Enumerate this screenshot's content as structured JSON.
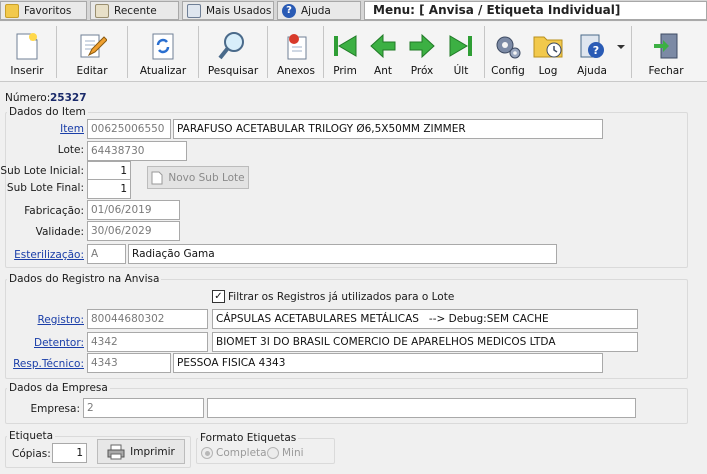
{
  "tabs": {
    "favoritos": "Favoritos",
    "recente": "Recente",
    "mais_usados": "Mais Usados",
    "ajuda": "Ajuda"
  },
  "menu_title": "Menu: [ Anvisa / Etiqueta Individual]",
  "toolbar": {
    "inserir": "Inserir",
    "editar": "Editar",
    "atualizar": "Atualizar",
    "pesquisar": "Pesquisar",
    "anexos": "Anexos",
    "prim": "Prim",
    "ant": "Ant",
    "prox": "Próx",
    "ult": "Últ",
    "config": "Config",
    "log": "Log",
    "ajuda": "Ajuda",
    "fechar": "Fechar"
  },
  "numero": {
    "label": "Número:",
    "value": "25327"
  },
  "dados_item": {
    "title": "Dados do Item",
    "item_label": "Item",
    "item_code": "00625006550",
    "item_desc": "PARAFUSO ACETABULAR TRILOGY Ø6,5X50MM ZIMMER",
    "lote_label": "Lote:",
    "lote_value": "64438730",
    "sub_lote_inicial_label": "Sub Lote Inicial:",
    "sub_lote_inicial_value": "1",
    "sub_lote_final_label": "Sub Lote Final:",
    "sub_lote_final_value": "1",
    "novo_sub_lote": "Novo Sub Lote",
    "fabricacao_label": "Fabricação:",
    "fabricacao_value": "01/06/2019",
    "validade_label": "Validade:",
    "validade_value": "30/06/2029",
    "esterilizacao_label": "Esterilização:",
    "esterilizacao_code": "A",
    "esterilizacao_desc": "Radiação Gama"
  },
  "dados_registro": {
    "title": "Dados do Registro na Anvisa",
    "filtrar_label": "Filtrar os Registros já utilizados para o Lote",
    "filtrar_checked": true,
    "registro_label": "Registro:",
    "registro_code": "80044680302",
    "registro_desc": "CÁPSULAS ACETABULARES METÁLICAS   --> Debug:SEM CACHE",
    "detentor_label": "Detentor:",
    "detentor_code": "4342",
    "detentor_desc": "BIOMET 3I DO BRASIL COMERCIO DE APARELHOS MEDICOS LTDA",
    "resp_label": "Resp.Técnico:",
    "resp_code": "4343",
    "resp_desc": "PESSOA FISICA 4343"
  },
  "dados_empresa": {
    "title": "Dados da Empresa",
    "empresa_label": "Empresa:",
    "empresa_code": "2",
    "empresa_desc": ""
  },
  "etiqueta": {
    "title": "Etiqueta",
    "copias_label": "Cópias:",
    "copias_value": "1",
    "imprimir": "Imprimir"
  },
  "formato": {
    "title": "Formato Etiquetas",
    "completa": "Completa",
    "mini": "Mini",
    "selected": "Completa"
  }
}
